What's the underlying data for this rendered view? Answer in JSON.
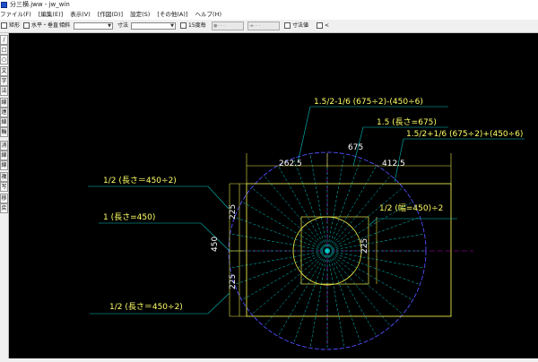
{
  "window": {
    "title": "分三横.jww - jw_win"
  },
  "menu": [
    "ファイル(F)",
    "[編集(E)]",
    "表示(V)",
    "[作図(D)]",
    "設定(S)",
    "[その他(A)]",
    "ヘルプ(H)"
  ],
  "toolbar": {
    "rect": "矩形",
    "hv": "水平・垂直",
    "tilt": "傾斜",
    "dim": "寸法",
    "deg15": "15度毎",
    "dim_value": "寸法値",
    "lt": "<"
  },
  "left_tools": [
    "/",
    "□",
    "○",
    "文",
    "字",
    "法",
    "線",
    "連",
    "線",
    "輪",
    "消",
    "線",
    "線",
    "複",
    "写",
    "移",
    "戻"
  ],
  "drawing": {
    "labels": {
      "formula_top": "1.5/2-1/6 (675÷2)-(450÷6)",
      "len675": "1.5 (長さ=675)",
      "formula_right": "1.5/2+1/6 (675÷2)+(450÷6)",
      "dim675": "675",
      "dim262": "262.5",
      "dim412": "412.5",
      "half_top": "1/2 (長さ＝450÷2)",
      "len450": "1 (長さ=450)",
      "half_bottom": "1/2 (長さ＝450÷2)",
      "width_half": "1/2 (幅=450)÷2",
      "dim450": "450",
      "dim225a": "225",
      "dim225b": "225",
      "dim225c": "225"
    },
    "colors": {
      "background": "#000000",
      "rect": "#e8e84a",
      "circle": "#5050ff",
      "radial": "#00d0d0",
      "leader": "#00bfbf",
      "dim_text": "#ffffff",
      "label_text": "#ffff66",
      "axis": "#c000c0"
    }
  }
}
